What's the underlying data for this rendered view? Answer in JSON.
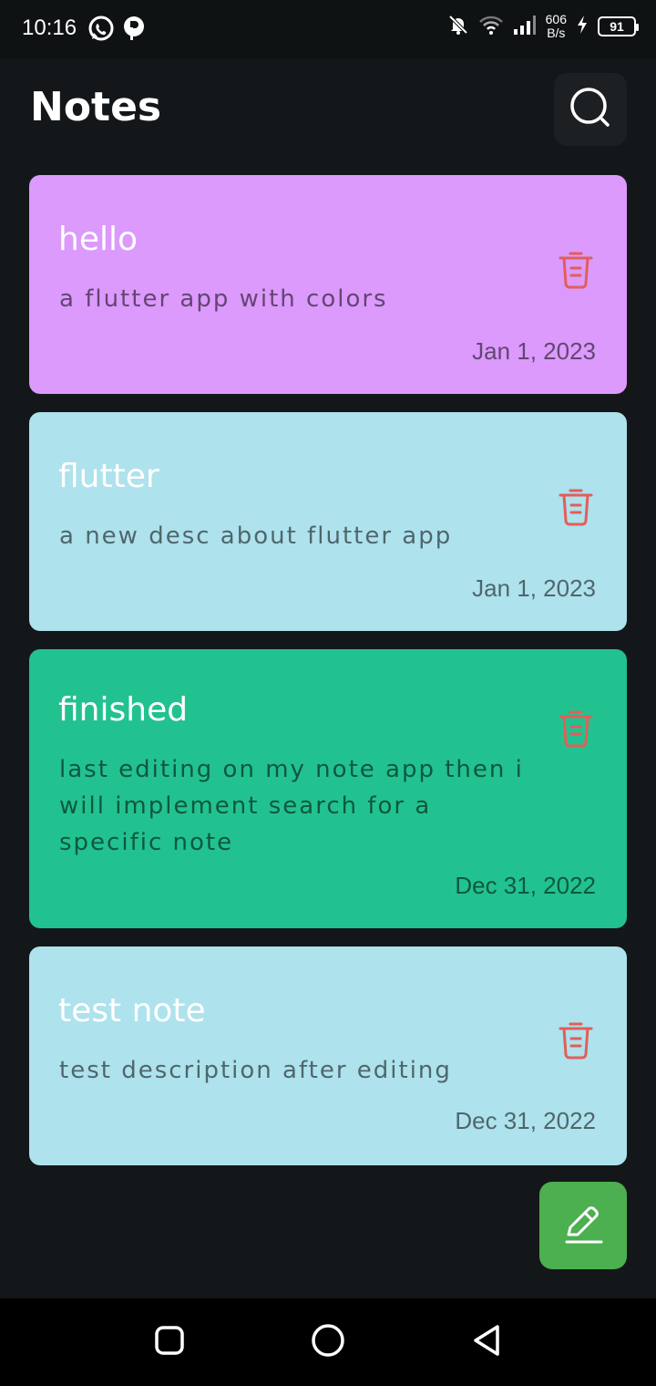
{
  "status_bar": {
    "time": "10:16",
    "net_speed_value": "606",
    "net_speed_unit": "B/s",
    "battery": "91",
    "icons": [
      "whatsapp-icon",
      "p-app-icon",
      "mute-bell-icon",
      "wifi-icon",
      "signal-icon",
      "charging-icon"
    ]
  },
  "header": {
    "title": "Notes",
    "search_icon": "search-icon"
  },
  "notes": [
    {
      "title": "hello",
      "description": "a flutter app with colors",
      "date": "Jan 1, 2023",
      "color": "#db9afc"
    },
    {
      "title": "flutter",
      "description": "a new desc about flutter app",
      "date": "Jan 1, 2023",
      "color": "#aee2ed"
    },
    {
      "title": "finished",
      "description": "last editing on my note app then i will implement search for a specific note",
      "date": "Dec 31, 2022",
      "color": "#21c290"
    },
    {
      "title": "test note",
      "description": "test description after editing",
      "date": "Dec 31, 2022",
      "color": "#aee2ed"
    }
  ],
  "colors": {
    "background": "#141719",
    "delete_icon": "#e25e5a",
    "fab": "#4caf50"
  },
  "fab": {
    "icon": "edit-icon"
  },
  "nav_bar": {
    "icons": [
      "recents-square-icon",
      "home-circle-icon",
      "back-triangle-icon"
    ]
  }
}
